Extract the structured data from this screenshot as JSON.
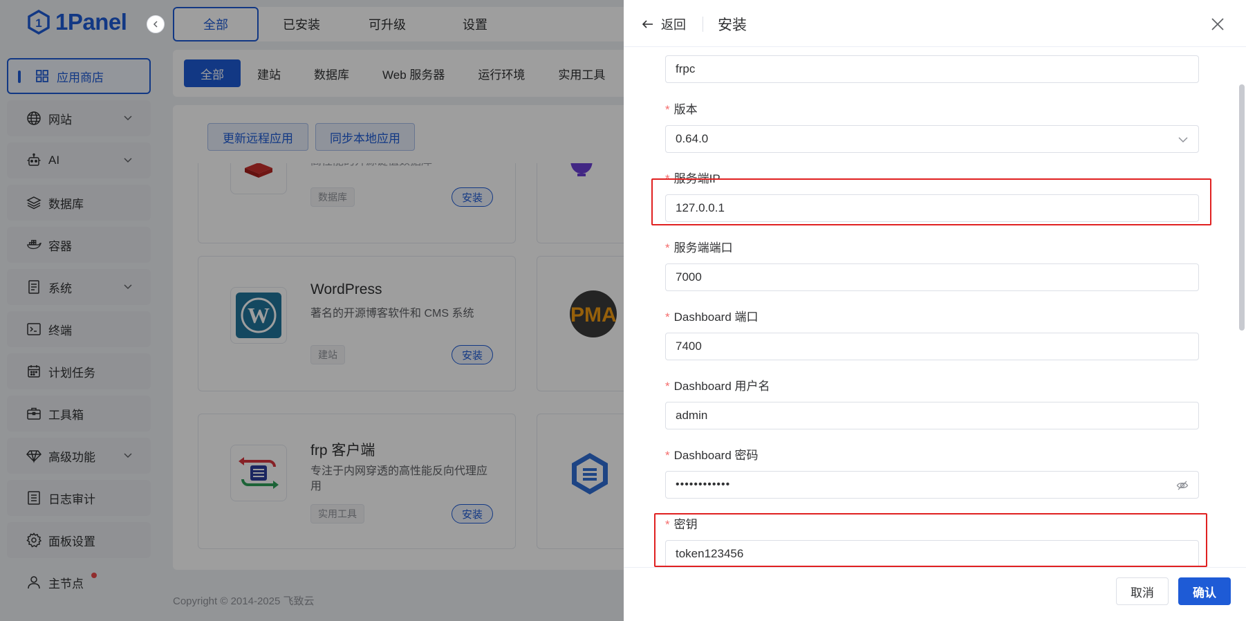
{
  "brand": {
    "name": "1Panel"
  },
  "sidebar": {
    "items": [
      {
        "label": "应用商店",
        "icon": "grid-icon"
      },
      {
        "label": "网站",
        "icon": "globe-icon"
      },
      {
        "label": "AI",
        "icon": "robot-icon"
      },
      {
        "label": "数据库",
        "icon": "layers-icon"
      },
      {
        "label": "容器",
        "icon": "docker-icon"
      },
      {
        "label": "系统",
        "icon": "system-icon"
      },
      {
        "label": "终端",
        "icon": "terminal-icon"
      },
      {
        "label": "计划任务",
        "icon": "calendar-icon"
      },
      {
        "label": "工具箱",
        "icon": "toolbox-icon"
      },
      {
        "label": "高级功能",
        "icon": "diamond-icon"
      },
      {
        "label": "日志审计",
        "icon": "log-icon"
      },
      {
        "label": "面板设置",
        "icon": "gear-icon"
      },
      {
        "label": "主节点",
        "icon": "user-icon"
      }
    ]
  },
  "top_tabs": [
    "全部",
    "已安装",
    "可升级",
    "设置"
  ],
  "filter_tabs": [
    "全部",
    "建站",
    "数据库",
    "Web 服务器",
    "运行环境",
    "实用工具"
  ],
  "actions": {
    "update_remote": "更新远程应用",
    "sync_local": "同步本地应用"
  },
  "apps": [
    {
      "name": "",
      "desc": "高性能的开源键值数据库",
      "tag": "数据库",
      "install": "安装"
    },
    {
      "name": "WordPress",
      "desc": "著名的开源博客软件和 CMS 系统",
      "tag": "建站",
      "install": "安装"
    },
    {
      "name": "frp 客户端",
      "desc": "专注于内网穿透的高性能反向代理应用",
      "tag": "实用工具",
      "install": "安装"
    }
  ],
  "footer": "Copyright © 2014-2025 飞致云",
  "drawer": {
    "back": "返回",
    "title": "安装",
    "fields": [
      {
        "label": "",
        "value": "frpc"
      },
      {
        "label": "版本",
        "value": "0.64.0"
      },
      {
        "label": "服务端IP",
        "value": "127.0.0.1"
      },
      {
        "label": "服务端端口",
        "value": "7000"
      },
      {
        "label": "Dashboard 端口",
        "value": "7400"
      },
      {
        "label": "Dashboard 用户名",
        "value": "admin"
      },
      {
        "label": "Dashboard 密码",
        "value": "••••••••••••"
      },
      {
        "label": "密钥",
        "value": "token123456"
      }
    ],
    "required_mark": "*",
    "cancel": "取消",
    "confirm": "确认"
  },
  "colors": {
    "primary": "#1e5bd6",
    "highlight": "#e02020",
    "required": "#f56c6c"
  }
}
